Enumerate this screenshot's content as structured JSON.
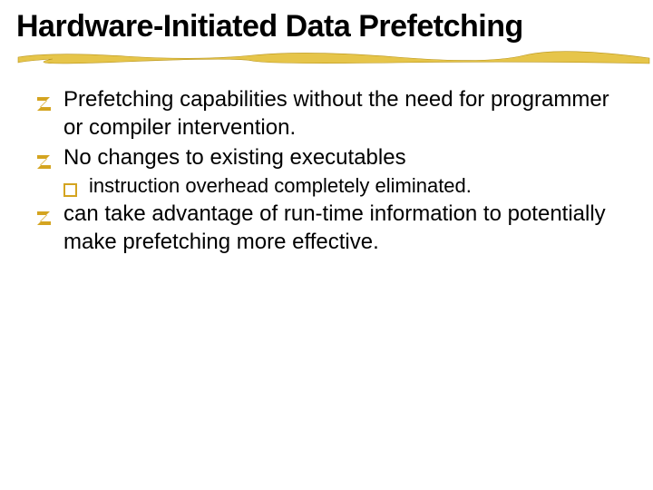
{
  "title": "Hardware-Initiated Data Prefetching",
  "colors": {
    "goldBullet": "#d4a420",
    "goldUnderline": "#e6c54a",
    "underlineShadow": "#b8941a"
  },
  "bullets": [
    {
      "level": 1,
      "text": "Prefetching capabilities without the need for programmer or compiler intervention."
    },
    {
      "level": 1,
      "text": "No changes to existing executables"
    },
    {
      "level": 2,
      "text": "instruction overhead completely eliminated."
    },
    {
      "level": 1,
      "text": "can take advantage of run-time information to potentially make prefetching more effective."
    }
  ]
}
